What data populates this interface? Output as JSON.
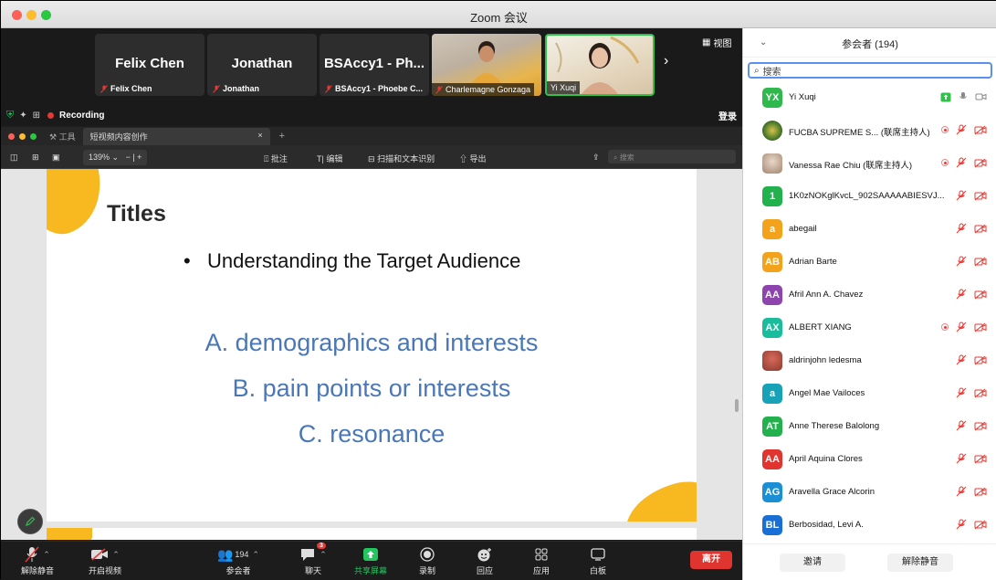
{
  "window": {
    "title": "Zoom 会议"
  },
  "video_strip": {
    "tiles": [
      {
        "big_name": "Felix Chen",
        "small_name": "Felix Chen"
      },
      {
        "big_name": "Jonathan",
        "small_name": "Jonathan"
      },
      {
        "big_name": "BSAccy1 - Ph...",
        "small_name": "BSAccy1 - Phoebe C..."
      },
      {
        "small_name": "Charlemagne Gonzaga"
      },
      {
        "small_name": "Yi Xuqi"
      }
    ],
    "view_label": "视图",
    "recording_label": "Recording",
    "login_label": "登录"
  },
  "app": {
    "tools_label": "工具",
    "tab_label": "短视频内容创作",
    "zoom": "139%",
    "annotate": "批注",
    "edit": "编辑",
    "ocr": "扫描和文本识别",
    "export": "导出",
    "search_placeholder": "搜索"
  },
  "slide": {
    "title": "Titles",
    "bullet": "Understanding the Target Audience",
    "lines": [
      "A. demographics and interests",
      "B. pain points or interests",
      "C. resonance"
    ]
  },
  "toolbar": {
    "unmute": "解除静音",
    "start_video": "开启视频",
    "participants_count": "194",
    "participants": "参会者",
    "chat": "聊天",
    "chat_badge": "3",
    "share": "共享屏幕",
    "record": "录制",
    "react": "回应",
    "apps": "应用",
    "whiteboard": "白板",
    "leave": "离开"
  },
  "panel": {
    "title": "参会者 (194)",
    "search_placeholder": "搜索",
    "invite": "邀请",
    "unmute_all": "解除静音",
    "participants": [
      {
        "initials": "YX",
        "color": "#2fb84c",
        "name": "Yi Xuqi",
        "share": true,
        "mic_on": true,
        "recording": true
      },
      {
        "initials": "",
        "avatar": "img4",
        "name": "FUCBA SUPREME S... (联席主持人)",
        "recording": true
      },
      {
        "initials": "",
        "avatar": "img2",
        "name": "Vanessa Rae Chiu (联席主持人)",
        "recording": true
      },
      {
        "initials": "1",
        "color": "#22b14c",
        "name": "1K0zNOKglKvcL_902SAAAAABIESVJ..."
      },
      {
        "initials": "a",
        "color": "#f2a21b",
        "name": "abegail"
      },
      {
        "initials": "AB",
        "color": "#f2a21b",
        "name": "Adrian Barte"
      },
      {
        "initials": "AA",
        "color": "#8e44ad",
        "name": "Afril Ann A. Chavez"
      },
      {
        "initials": "AX",
        "color": "#1abc9c",
        "name": "ALBERT XIANG",
        "recording": true
      },
      {
        "initials": "",
        "avatar": "img3",
        "name": "aldrinjohn ledesma"
      },
      {
        "initials": "a",
        "color": "#17a2b8",
        "name": "Angel Mae Vailoces"
      },
      {
        "initials": "AT",
        "color": "#22b14c",
        "name": "Anne Therese Balolong"
      },
      {
        "initials": "AA",
        "color": "#e0342f",
        "name": "April Aquina Clores"
      },
      {
        "initials": "AG",
        "color": "#1a8fd6",
        "name": "Aravella Grace Alcorin"
      },
      {
        "initials": "BL",
        "color": "#1a6fd6",
        "name": "Berbosidad, Levi A."
      }
    ]
  }
}
